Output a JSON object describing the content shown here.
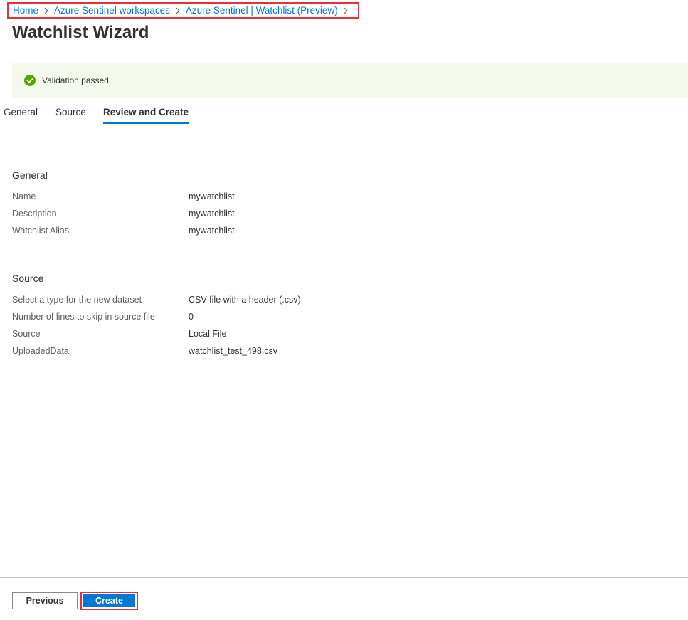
{
  "breadcrumb": {
    "items": [
      {
        "label": "Home"
      },
      {
        "label": "Azure Sentinel workspaces"
      },
      {
        "label": "Azure Sentinel | Watchlist (Preview)"
      }
    ]
  },
  "page": {
    "title": "Watchlist Wizard"
  },
  "banner": {
    "text": "Validation passed.",
    "status_color": "#57a300",
    "background_color": "#f3f9ed"
  },
  "tabs": [
    {
      "label": "General",
      "selected": false
    },
    {
      "label": "Source",
      "selected": false
    },
    {
      "label": "Review and Create",
      "selected": true
    }
  ],
  "general": {
    "heading": "General",
    "rows": [
      {
        "label": "Name",
        "value": "mywatchlist"
      },
      {
        "label": "Description",
        "value": "mywatchlist"
      },
      {
        "label": "Watchlist Alias",
        "value": "mywatchlist"
      }
    ]
  },
  "source": {
    "heading": "Source",
    "rows": [
      {
        "label": "Select a type for the new dataset",
        "value": "CSV file with a header (.csv)"
      },
      {
        "label": "Number of lines to skip in source file",
        "value": "0"
      },
      {
        "label": "Source",
        "value": "Local File"
      },
      {
        "label": "UploadedData",
        "value": "watchlist_test_498.csv"
      }
    ]
  },
  "footer": {
    "previous_label": "Previous",
    "create_label": "Create"
  },
  "colors": {
    "accent": "#0078d4",
    "highlight_border": "#e3323c"
  }
}
